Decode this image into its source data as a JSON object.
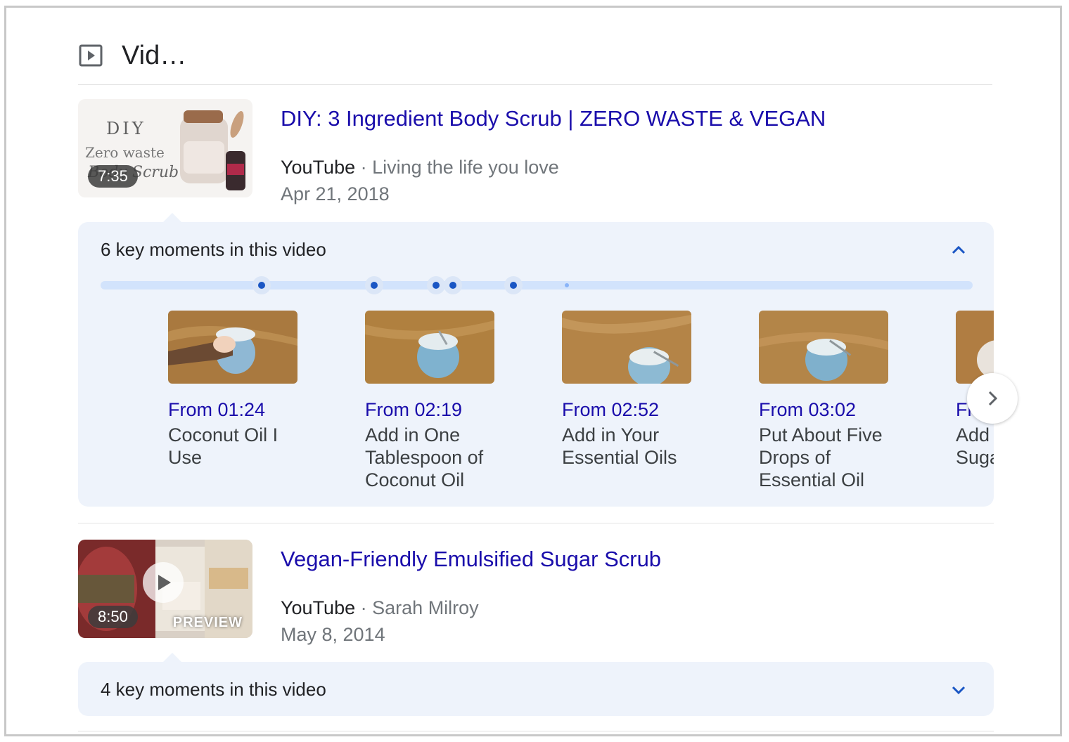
{
  "section": {
    "title": "Vid…",
    "icon": "video-play-icon"
  },
  "videos": [
    {
      "title": "DIY: 3 Ingredient Body Scrub | ZERO WASTE & VEGAN",
      "source": "YouTube",
      "separator": "·",
      "channel": "Living the life you love",
      "date": "Apr 21, 2018",
      "duration": "7:35",
      "thumb_text": {
        "line1": "DIY",
        "line2": "Zero waste",
        "line3": "Body Scrub"
      },
      "key_moments": {
        "heading": "6 key moments in this video",
        "expanded": true,
        "moments": [
          {
            "from": "From 01:24",
            "label": "Coconut Oil I Use"
          },
          {
            "from": "From 02:19",
            "label": "Add in One Tablespoon of Coconut Oil"
          },
          {
            "from": "From 02:52",
            "label": "Add in Your Essential Oils"
          },
          {
            "from": "From 03:02",
            "label": "Put About Five Drops of Essential Oil"
          },
          {
            "from": "From",
            "label": "Add Tablespoon Sugar"
          }
        ]
      }
    },
    {
      "title": "Vegan-Friendly Emulsified Sugar Scrub",
      "source": "YouTube",
      "separator": "·",
      "channel": "Sarah Milroy",
      "date": "May 8, 2014",
      "duration": "8:50",
      "preview_label": "PREVIEW",
      "key_moments": {
        "heading": "4 key moments in this video",
        "expanded": false
      }
    }
  ],
  "colors": {
    "link": "#1a0dab",
    "panel_bg": "#eef3fb",
    "timeline": "#d2e3fc",
    "accent": "#1a56c4"
  }
}
